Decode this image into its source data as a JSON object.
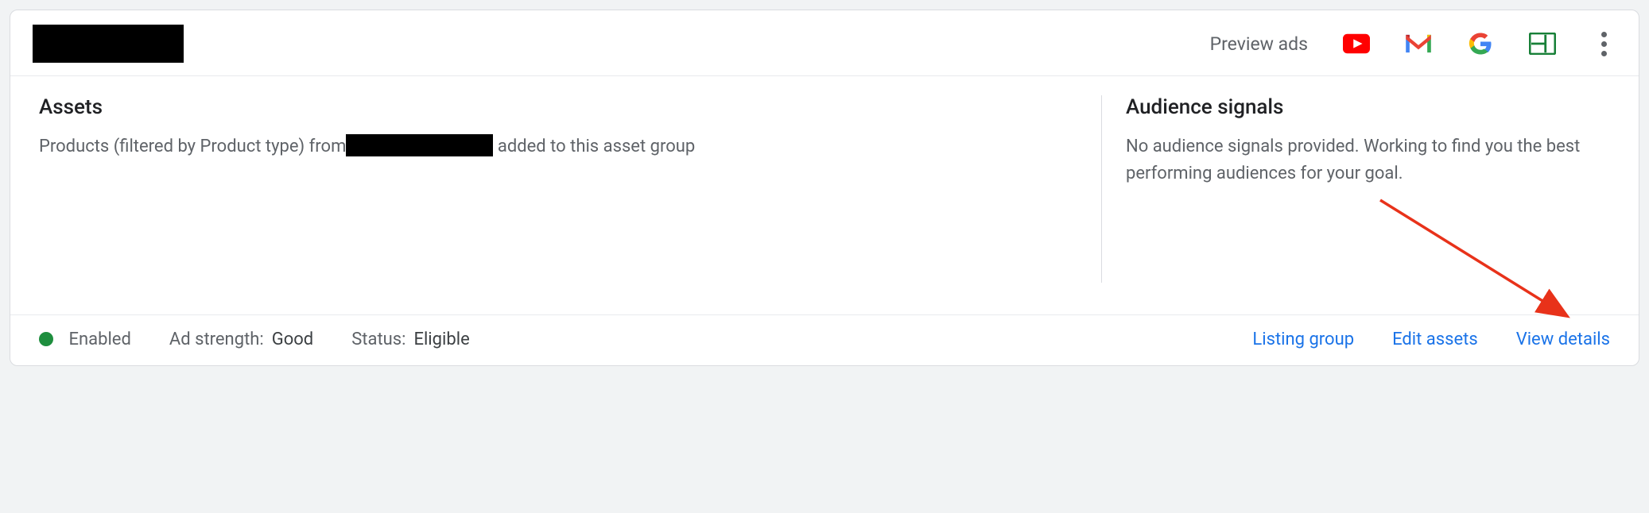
{
  "header": {
    "title_redacted": true,
    "preview_label": "Preview ads",
    "icons": [
      "youtube-icon",
      "gmail-icon",
      "google-g-icon",
      "display-icon"
    ],
    "more_icon": "more-vert-icon"
  },
  "assets": {
    "heading": "Assets",
    "text_prefix": "Products (filtered by Product type) from",
    "text_suffix": " added to this asset group"
  },
  "audience": {
    "heading": "Audience signals",
    "text": "No audience signals provided. Working to find you the best performing audiences for your goal."
  },
  "footer": {
    "enabled_label": "Enabled",
    "ad_strength_label": "Ad strength:",
    "ad_strength_value": "Good",
    "status_label": "Status:",
    "status_value": "Eligible",
    "actions": {
      "listing_group": "Listing group",
      "edit_assets": "Edit assets",
      "view_details": "View details"
    }
  },
  "colors": {
    "link": "#1a73e8",
    "enabled_dot": "#1e8e3e",
    "arrow": "#e8321a"
  }
}
